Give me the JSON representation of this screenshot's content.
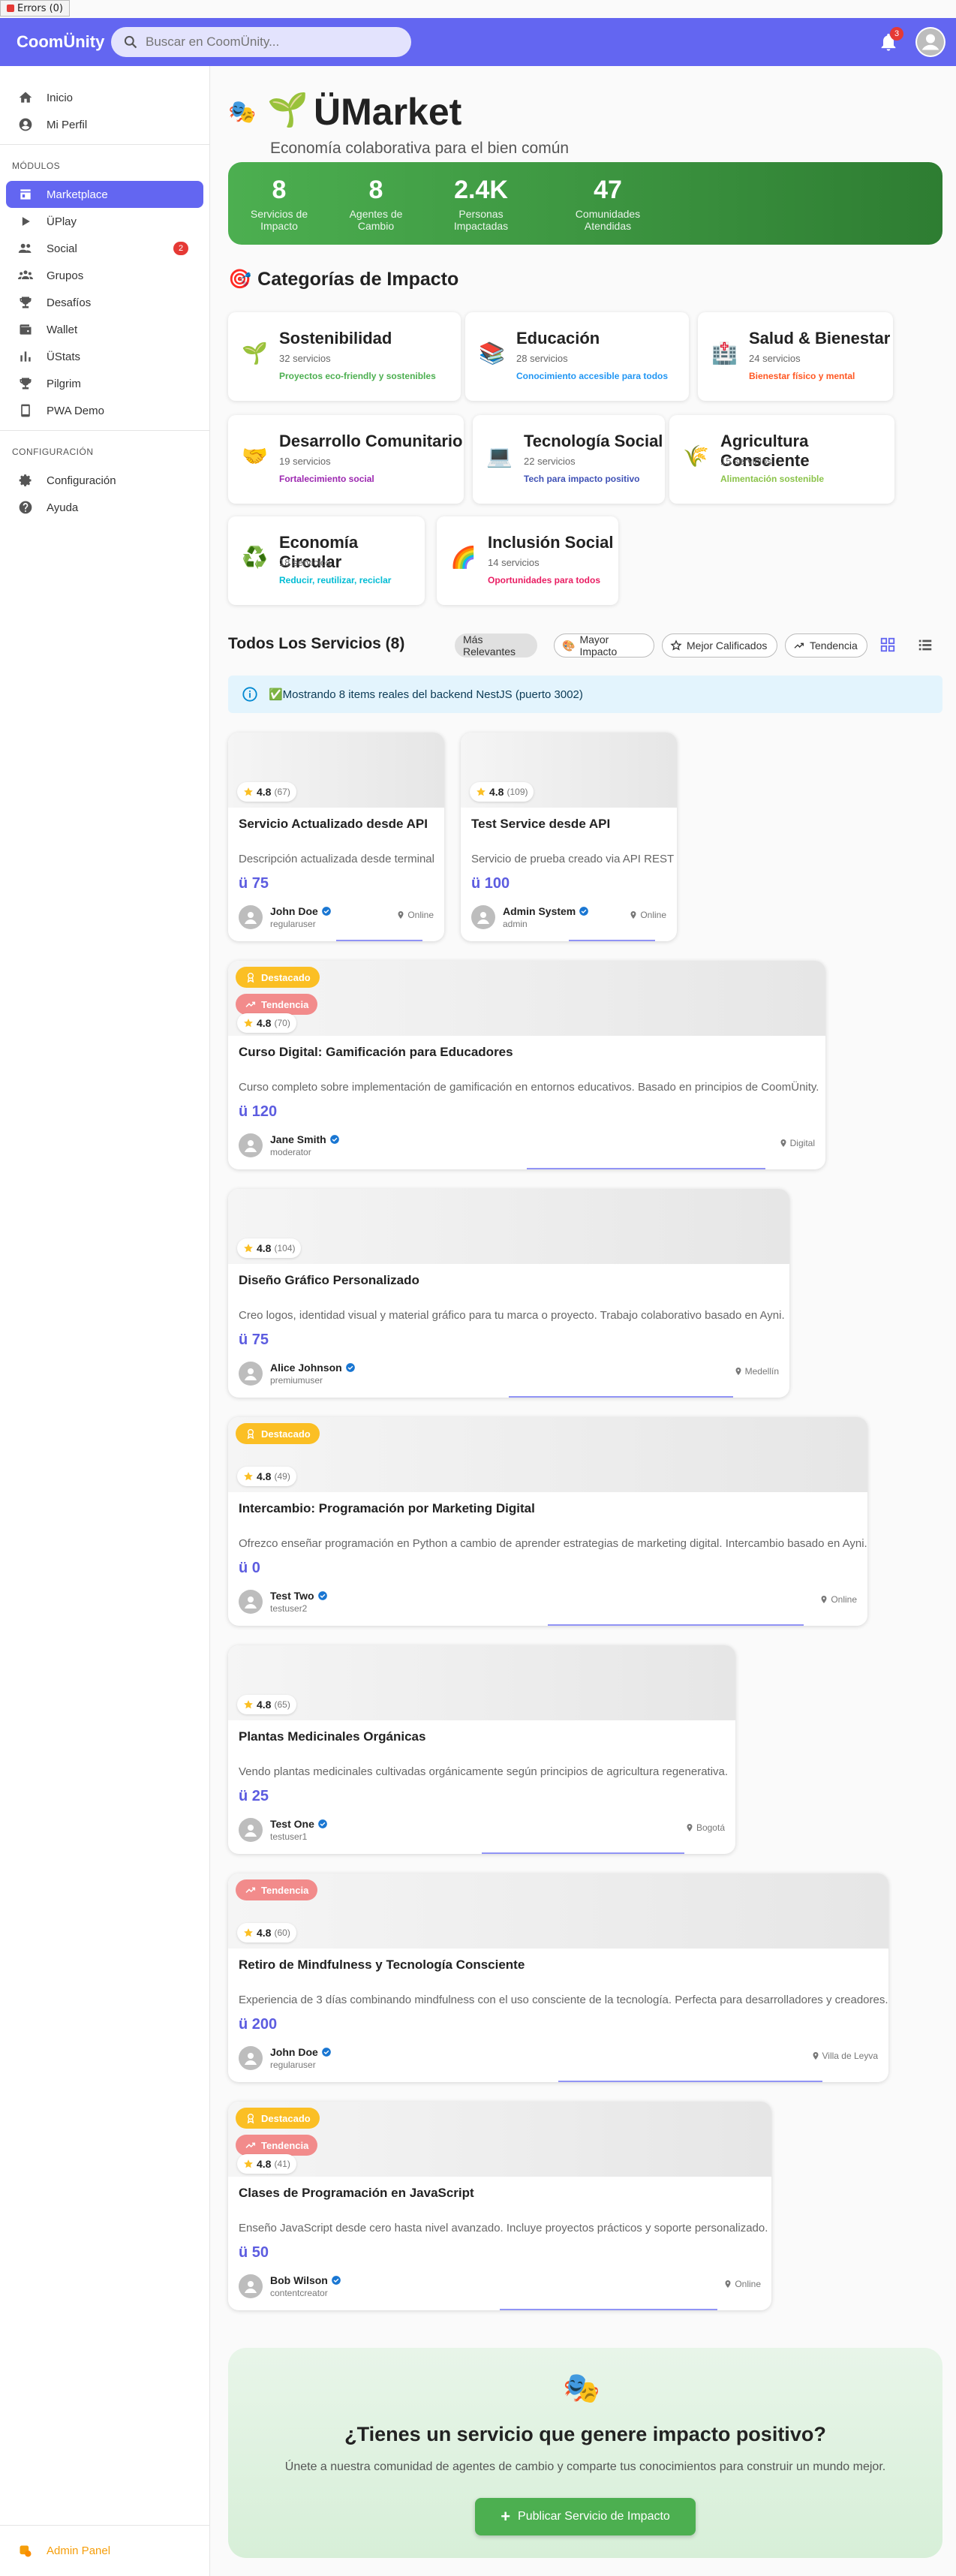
{
  "errors_label": "Errors (0)",
  "app": {
    "logo": "CoomÜnity",
    "search_placeholder": "Buscar en CoomÜnity...",
    "notif_count": "3"
  },
  "sidebar": {
    "top": [
      {
        "label": "Inicio",
        "icon": "home-icon"
      },
      {
        "label": "Mi Perfil",
        "icon": "account-icon"
      }
    ],
    "modules_title": "MÓDULOS",
    "modules": [
      {
        "label": "Marketplace",
        "icon": "store-icon",
        "active": true
      },
      {
        "label": "ÜPlay",
        "icon": "play-icon"
      },
      {
        "label": "Social",
        "icon": "people-icon",
        "badge": "2"
      },
      {
        "label": "Grupos",
        "icon": "groups-icon"
      },
      {
        "label": "Desafíos",
        "icon": "trophy-icon"
      },
      {
        "label": "Wallet",
        "icon": "wallet-icon"
      },
      {
        "label": "ÜStats",
        "icon": "stats-icon"
      },
      {
        "label": "Pilgrim",
        "icon": "trophy-icon"
      },
      {
        "label": "PWA Demo",
        "icon": "phone-icon"
      }
    ],
    "config_title": "CONFIGURACIÓN",
    "config": [
      {
        "label": "Configuración",
        "icon": "gear-icon"
      },
      {
        "label": "Ayuda",
        "icon": "help-icon"
      }
    ],
    "admin": "Admin Panel"
  },
  "hero": {
    "title": "ÜMarket",
    "subtitle": "Economía colaborativa para el bien común"
  },
  "stats": [
    {
      "value": "8",
      "label": "Servicios de Impacto"
    },
    {
      "value": "8",
      "label": "Agentes de Cambio"
    },
    {
      "value": "2.4K",
      "label": "Personas Impactadas"
    },
    {
      "value": "47",
      "label": "Comunidades Atendidas"
    }
  ],
  "categories_title": "Categorías de Impacto",
  "categories": [
    {
      "title": "Sostenibilidad",
      "count": "32 servicios",
      "tag": "Proyectos eco-friendly y sostenibles",
      "color": "#4caf50",
      "icon": "🌱"
    },
    {
      "title": "Educación",
      "count": "28 servicios",
      "tag": "Conocimiento accesible para todos",
      "color": "#2196f3",
      "icon": "📚"
    },
    {
      "title": "Salud & Bienestar",
      "count": "24 servicios",
      "tag": "Bienestar físico y mental",
      "color": "#ff5722",
      "icon": "🏥"
    },
    {
      "title": "Desarrollo Comunitario",
      "count": "19 servicios",
      "tag": "Fortalecimiento social",
      "color": "#9c27b0",
      "icon": "🤝"
    },
    {
      "title": "Tecnología Social",
      "count": "22 servicios",
      "tag": "Tech para impacto positivo",
      "color": "#3f51b5",
      "icon": "💻"
    },
    {
      "title": "Agricultura Consciente",
      "count": "15 servicios",
      "tag": "Alimentación sostenible",
      "color": "#8bc34a",
      "icon": "🌾"
    },
    {
      "title": "Economía Circular",
      "count": "18 servicios",
      "tag": "Reducir, reutilizar, reciclar",
      "color": "#00bcd4",
      "icon": "♻️"
    },
    {
      "title": "Inclusión Social",
      "count": "14 servicios",
      "tag": "Oportunidades para todos",
      "color": "#e91e63",
      "icon": "🌈"
    }
  ],
  "services_title": "Todos Los Servicios (8)",
  "filters": [
    "Más Relevantes",
    "Mayor Impacto",
    "Mejor Calificados",
    "Tendencia"
  ],
  "info": "✅Mostrando 8 items reales del backend NestJS (puerto 3002)",
  "badges": {
    "featured": "Destacado",
    "trending": "Tendencia"
  },
  "services": [
    {
      "rating": "4.8",
      "reviews": "(67)",
      "title": "Servicio Actualizado desde API",
      "desc": "Descripción actualizada desde terminal",
      "price": "ü 75",
      "owner": "John Doe",
      "role": "regularuser",
      "location": "Online",
      "progress": 0.4
    },
    {
      "rating": "4.8",
      "reviews": "(109)",
      "title": "Test Service desde API",
      "desc": "Servicio de prueba creado via API REST",
      "price": "ü 100",
      "owner": "Admin System",
      "role": "admin",
      "location": "Online",
      "progress": 0.4
    },
    {
      "rating": "4.8",
      "reviews": "(70)",
      "title": "Curso Digital: Gamificación para Educadores",
      "desc": "Curso completo sobre implementación de gamificación en entornos educativos. Basado en principios de CoomÜnity.",
      "price": "ü 120",
      "owner": "Jane Smith",
      "role": "moderator",
      "location": "Digital",
      "featured": true,
      "trending": true,
      "progress": 0.4
    },
    {
      "rating": "4.8",
      "reviews": "(104)",
      "title": "Diseño Gráfico Personalizado",
      "desc": "Creo logos, identidad visual y material gráfico para tu marca o proyecto. Trabajo colaborativo basado en Ayni.",
      "price": "ü 75",
      "owner": "Alice Johnson",
      "role": "premiumuser",
      "location": "Medellín",
      "progress": 0.4
    },
    {
      "rating": "4.8",
      "reviews": "(49)",
      "title": "Intercambio: Programación por Marketing Digital",
      "desc": "Ofrezco enseñar programación en Python a cambio de aprender estrategias de marketing digital. Intercambio basado en Ayni.",
      "price": "ü 0",
      "owner": "Test Two",
      "role": "testuser2",
      "location": "Online",
      "featured": true,
      "progress": 0.4
    },
    {
      "rating": "4.8",
      "reviews": "(65)",
      "title": "Plantas Medicinales Orgánicas",
      "desc": "Vendo plantas medicinales cultivadas orgánicamente según principios de agricultura regenerativa.",
      "price": "ü 25",
      "owner": "Test One",
      "role": "testuser1",
      "location": "Bogotá",
      "progress": 0.4
    },
    {
      "rating": "4.8",
      "reviews": "(60)",
      "title": "Retiro de Mindfulness y Tecnología Consciente",
      "desc": "Experiencia de 3 días combinando mindfulness con el uso consciente de la tecnología. Perfecta para desarrolladores y creadores.",
      "price": "ü 200",
      "owner": "John Doe",
      "role": "regularuser",
      "location": "Villa de Leyva",
      "trending": true,
      "progress": 0.4
    },
    {
      "rating": "4.8",
      "reviews": "(41)",
      "title": "Clases de Programación en JavaScript",
      "desc": "Enseño JavaScript desde cero hasta nivel avanzado. Incluye proyectos prácticos y soporte personalizado.",
      "price": "ü 50",
      "owner": "Bob Wilson",
      "role": "contentcreator",
      "location": "Online",
      "featured": true,
      "trending": true,
      "progress": 0.4
    }
  ],
  "cta": {
    "title": "¿Tienes un servicio que genere impacto positivo?",
    "text": "Únete a nuestra comunidad de agentes de cambio y comparte tus conocimientos para construir un mundo mejor.",
    "button": "Publicar Servicio de Impacto"
  }
}
